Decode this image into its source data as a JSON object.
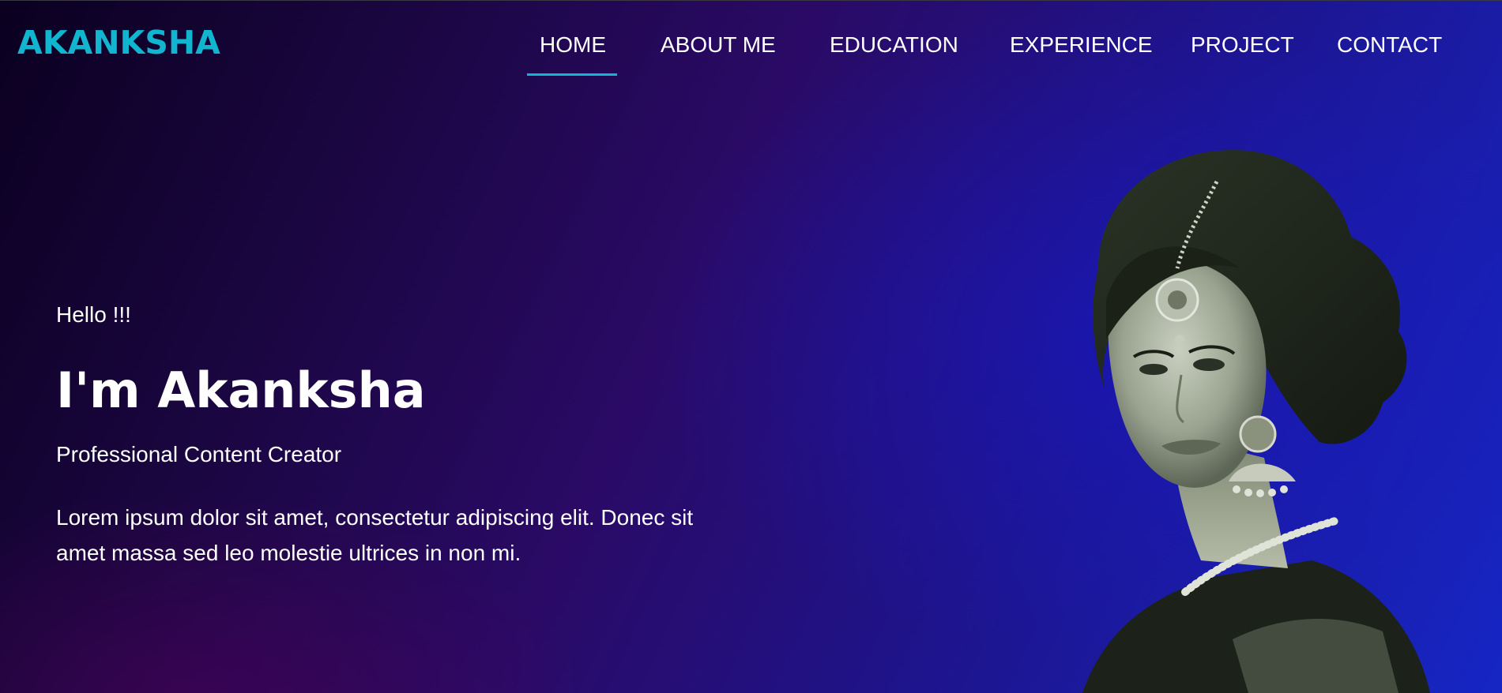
{
  "brand": {
    "logo": "AKANKSHA"
  },
  "nav": {
    "items": [
      {
        "label": "HOME",
        "active": true
      },
      {
        "label": "ABOUT ME",
        "active": false
      },
      {
        "label": "EDUCATION",
        "active": false
      },
      {
        "label": "EXPERIENCE",
        "active": false
      },
      {
        "label": "PROJECT",
        "active": false
      },
      {
        "label": "CONTACT",
        "active": false
      }
    ]
  },
  "hero": {
    "greeting": "Hello !!!",
    "headline": "I'm Akanksha",
    "role": "Professional Content Creator",
    "description": "Lorem ipsum dolor sit amet, consectetur adipiscing elit. Donec sit amet massa sed leo molestie ultrices in non mi."
  },
  "colors": {
    "accent": "#12b5cf",
    "text": "#ffffff",
    "background_start": "#0b0020",
    "background_end": "#1626c4"
  }
}
